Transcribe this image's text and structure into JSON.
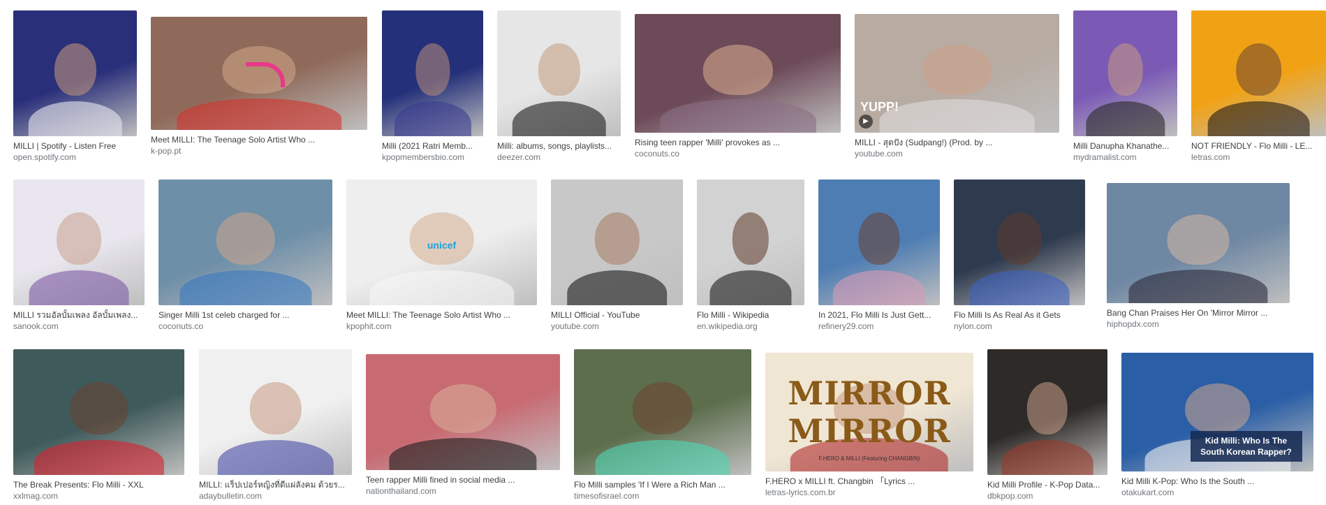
{
  "results": [
    {
      "caption": "MILLI | Spotify - Listen Free",
      "source": "open.spotify.com",
      "bg": "#2a2f7a",
      "skin": "#c89a7a",
      "cloth": "#e8e8ee"
    },
    {
      "caption": "Meet MILLI: The Teenage Solo Artist Who ...",
      "source": "k-pop.pt",
      "bg": "#8f6a5a",
      "skin": "#d4a88a",
      "cloth": "#d3332e",
      "extra": "arrow"
    },
    {
      "caption": "Milli (2021 Ratri Memb...",
      "source": "kpopmembersbio.com",
      "bg": "#24307a",
      "skin": "#b98e78",
      "cloth": "#3b3c8f"
    },
    {
      "caption": "Milli: albums, songs, playlists...",
      "source": "deezer.com",
      "bg": "#e6e6e6",
      "skin": "#c39a7c",
      "cloth": "#1d1d1d"
    },
    {
      "caption": "Rising teen rapper 'Milli' provokes as ...",
      "source": "coconuts.co",
      "bg": "#6d4a58",
      "skin": "#dcae90",
      "cloth": "#8b6f86"
    },
    {
      "caption": "MILLI - สุดปัง (Sudpang!) (Prod. by ...",
      "source": "youtube.com",
      "bg": "#b7aba2",
      "skin": "#cfa188",
      "cloth": "#e0dcdc",
      "extra": "play"
    },
    {
      "caption": "Milli Danupha Khanathe...",
      "source": "mydramalist.com",
      "bg": "#7b5ab6",
      "skin": "#c89b80",
      "cloth": "#2a2a2a"
    },
    {
      "caption": "NOT FRIENDLY - Flo Milli - LE...",
      "source": "letras.com",
      "bg": "#f1a214",
      "skin": "#6b4330",
      "cloth": "#231a15"
    },
    {
      "caption": "MILLI รวมอัลบั้มเพลง อัลบั้มเพลง...",
      "source": "sanook.com",
      "bg": "#e9e6ef",
      "skin": "#c9a08c",
      "cloth": "#7b5aa3"
    },
    {
      "caption": "Singer Milli 1st celeb charged for ...",
      "source": "coconuts.co",
      "bg": "#6e8fa8",
      "skin": "#d0a58a",
      "cloth": "#3a7ac0"
    },
    {
      "caption": "Meet MILLI: The Teenage Solo Artist Who ...",
      "source": "kpophit.com",
      "bg": "#eeeeee",
      "skin": "#d7ae92",
      "cloth": "#f7f7f7",
      "overlay": "unicef"
    },
    {
      "caption": "MILLI Official - YouTube",
      "source": "youtube.com",
      "bg": "#c8c8c8",
      "skin": "#a57a62",
      "cloth": "#1a1a1a"
    },
    {
      "caption": "Flo Milli - Wikipedia",
      "source": "en.wikipedia.org",
      "bg": "#d2d2d2",
      "skin": "#5e3a2a",
      "cloth": "#1c1c1c"
    },
    {
      "caption": "In 2021, Flo Milli Is Just Gett...",
      "source": "refinery29.com",
      "bg": "#4e7db3",
      "skin": "#6a4232",
      "cloth": "#d79bb6"
    },
    {
      "caption": "Flo Milli Is As Real As it Gets",
      "source": "nylon.com",
      "bg": "#2e3a4e",
      "skin": "#5f3b2c",
      "cloth": "#3d62c1"
    },
    {
      "caption": "Bang Chan Praises Her On 'Mirror Mirror ...",
      "source": "hiphopdx.com",
      "bg": "#6e87a3",
      "skin": "#d5b6a2",
      "cloth": "#2a2a3a"
    },
    {
      "caption": "The Break Presents: Flo Milli - XXL",
      "source": "xxlmag.com",
      "bg": "#3f5a5a",
      "skin": "#6b4131",
      "cloth": "#d8222e"
    },
    {
      "caption": "MILLI: แร็ปเปอร์หญิงที่ดีแผ่ลังคม ด้วยร...",
      "source": "adaybulletin.com",
      "bg": "#f0f0f0",
      "skin": "#c89b84",
      "cloth": "#4a4fa8"
    },
    {
      "caption": "Teen rapper Milli fined in social media ...",
      "source": "nationthailand.com",
      "bg": "#c86a72",
      "skin": "#d8b09a",
      "cloth": "#1d1d1d"
    },
    {
      "caption": "Flo Milli samples 'If I Were a Rich Man ...",
      "source": "timesofisrael.com",
      "bg": "#5c6e4c",
      "skin": "#6d4332",
      "cloth": "#4ed7b4"
    },
    {
      "caption": "F.HERO x MILLI ft. Changbin 「Lyrics ...",
      "source": "letras-lyrics.com.br",
      "bg": "#f0e6d4",
      "skin": "#c69a80",
      "cloth": "#b32c2c",
      "overlay": "MIRROR MIRROR",
      "overlay_sub": "F.HERO & MILLI (Featuring CHANGBIN)"
    },
    {
      "caption": "Kid Milli Profile - K-Pop Data...",
      "source": "dbkpop.com",
      "bg": "#2e2a28",
      "skin": "#c9a08a",
      "cloth": "#9a3a2a"
    },
    {
      "caption": "Kid Milli K-Pop: Who Is the South ...",
      "source": "otakukart.com",
      "bg": "#2a5ea6",
      "skin": "#cfa58e",
      "cloth": "#f2f2f2",
      "overlay": "Kid Milli: Who Is The South Korean Rapper?"
    }
  ],
  "extras": {
    "unicef_text": "unicef",
    "mirror_title": "MIRROR MIRROR",
    "mirror_sub": "F.HERO & MILLI (Featuring CHANGBIN)",
    "kid_box": "Kid Milli: Who Is The South Korean Rapper?",
    "yupp_text": "YUPP!",
    "play_glyph": "▶"
  }
}
